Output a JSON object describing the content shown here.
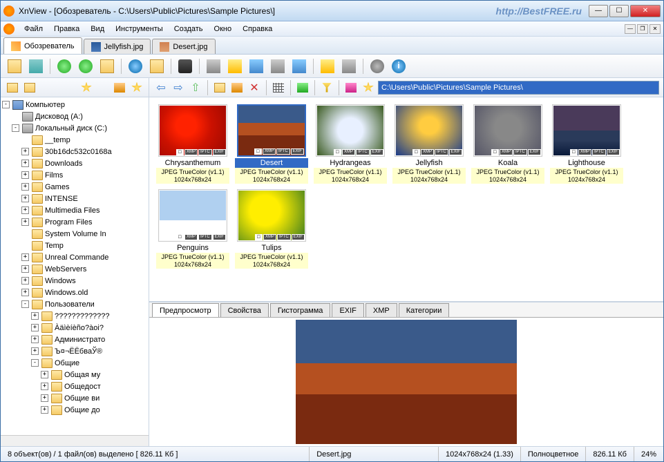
{
  "window": {
    "title": "XnView - [Обозреватель - C:\\Users\\Public\\Pictures\\Sample Pictures\\]",
    "watermark": "http://BestFREE.ru"
  },
  "menu": {
    "items": [
      "Файл",
      "Правка",
      "Вид",
      "Инструменты",
      "Создать",
      "Окно",
      "Справка"
    ]
  },
  "tabs": [
    {
      "label": "Обозреватель",
      "active": true,
      "icon": "browser"
    },
    {
      "label": "Jellyfish.jpg",
      "active": false,
      "icon": "img1"
    },
    {
      "label": "Desert.jpg",
      "active": false,
      "icon": "img2"
    }
  ],
  "address": "C:\\Users\\Public\\Pictures\\Sample Pictures\\",
  "tree": {
    "root": "Компьютер",
    "driveA": "Дисковод (A:)",
    "driveC": "Локальный диск (C:)",
    "folders": [
      "__temp",
      "30b16dc532c0168a",
      "Downloads",
      "Films",
      "Games",
      "INTENSE",
      "Multimedia Files",
      "Program Files",
      "System Volume In",
      "Temp",
      "Unreal Commande",
      "WebServers",
      "Windows",
      "Windows.old",
      "Пользователи"
    ],
    "users_children": [
      "?????????????",
      "Àäìèíèño?àoi?",
      "Администрато",
      "Ъ¤¬Ё­ЁбваЎ®",
      "Общие"
    ],
    "public_children": [
      "Общая му",
      "Общедост",
      "Общие ви",
      "Общие до"
    ]
  },
  "thumbs": [
    {
      "name": "Chrysanthemum",
      "meta": "JPEG TrueColor (v1.1)",
      "dim": "1024x768x24",
      "cls": "img-chrys",
      "selected": false
    },
    {
      "name": "Desert",
      "meta": "JPEG TrueColor (v1.1)",
      "dim": "1024x768x24",
      "cls": "img-desert",
      "selected": true
    },
    {
      "name": "Hydrangeas",
      "meta": "JPEG TrueColor (v1.1)",
      "dim": "1024x768x24",
      "cls": "img-hydra",
      "selected": false
    },
    {
      "name": "Jellyfish",
      "meta": "JPEG TrueColor (v1.1)",
      "dim": "1024x768x24",
      "cls": "img-jelly",
      "selected": false
    },
    {
      "name": "Koala",
      "meta": "JPEG TrueColor (v1.1)",
      "dim": "1024x768x24",
      "cls": "img-koala",
      "selected": false
    },
    {
      "name": "Lighthouse",
      "meta": "JPEG TrueColor (v1.1)",
      "dim": "1024x768x24",
      "cls": "img-light",
      "selected": false
    },
    {
      "name": "Penguins",
      "meta": "JPEG TrueColor (v1.1)",
      "dim": "1024x768x24",
      "cls": "img-peng",
      "selected": false
    },
    {
      "name": "Tulips",
      "meta": "JPEG TrueColor (v1.1)",
      "dim": "1024x768x24",
      "cls": "img-tulip",
      "selected": false
    }
  ],
  "badges": [
    "XMP",
    "IPTC",
    "EXIF"
  ],
  "preview_tabs": [
    "Предпросмотр",
    "Свойства",
    "Гистограмма",
    "EXIF",
    "XMP",
    "Категории"
  ],
  "status": {
    "objects": "8 объект(ов) / 1 файл(ов) выделено   [ 826.11 Кб ]",
    "filename": "Desert.jpg",
    "dims": "1024x768x24 (1.33)",
    "color": "Полноцветное",
    "size": "826.11 Кб",
    "zoom": "24%"
  }
}
